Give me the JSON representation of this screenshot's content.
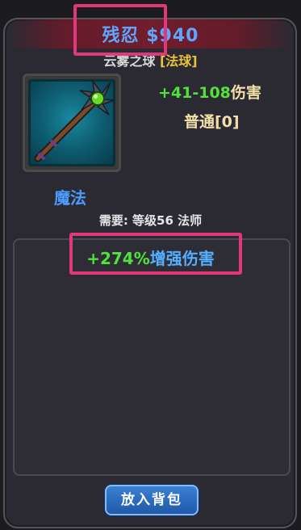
{
  "item": {
    "name": "残忍 $940",
    "base_name": "云雾之球",
    "type_tag": "[法球]",
    "damage_value": "+41-108",
    "damage_label": "伤害",
    "quality": "普通[0]",
    "category": "魔法",
    "requirement": "需要: 等级56 法师",
    "icon": "magic-staff-icon"
  },
  "stats": [
    {
      "value": "+274%",
      "label": "增强伤害"
    }
  ],
  "actions": {
    "put_in_bag": "放入背包"
  },
  "colors": {
    "title": "#5fa6ff",
    "type_tag": "#e8c23a",
    "bonus_green": "#4fe33c",
    "stat_blue": "#54b0ff",
    "highlight": "#e0387a",
    "button": "#2a6cc0"
  }
}
